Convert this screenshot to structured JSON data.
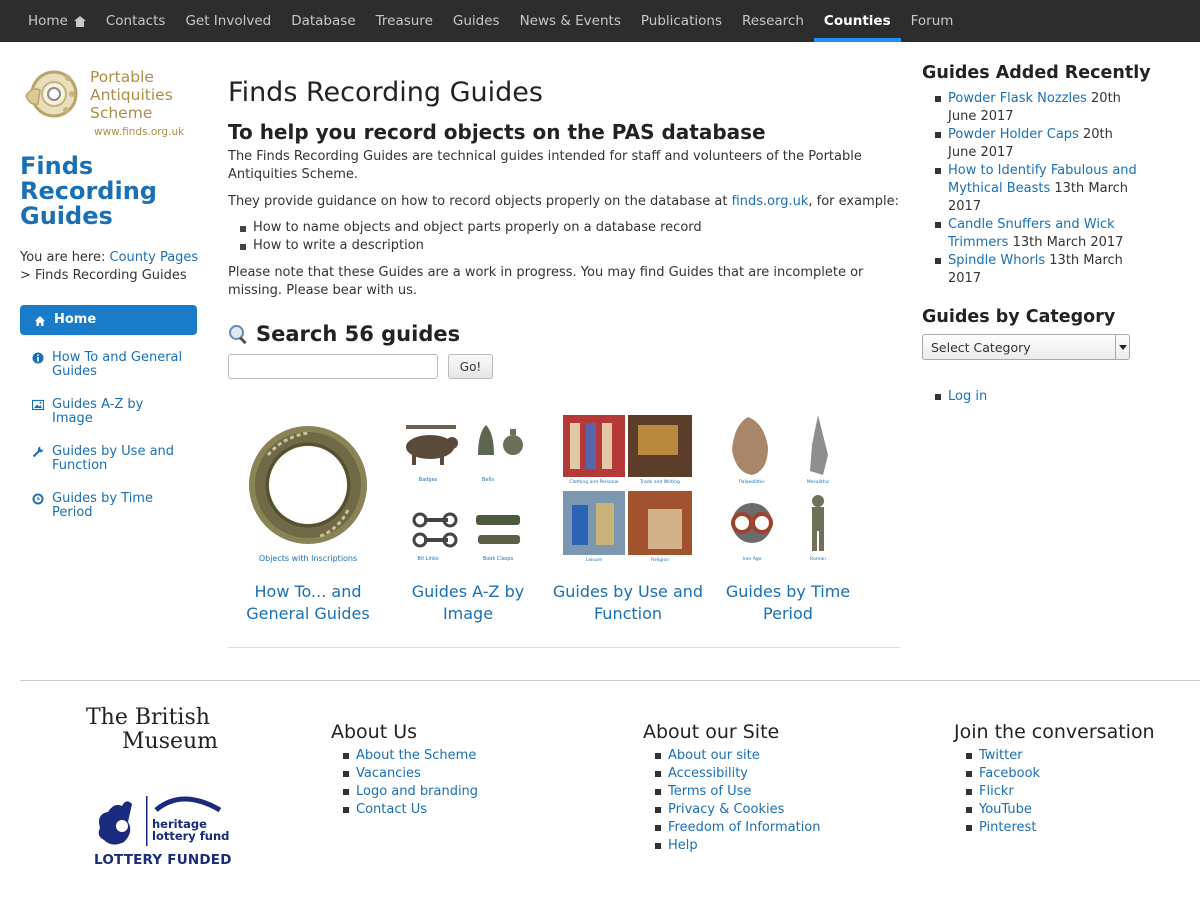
{
  "topnav": {
    "items": [
      {
        "label": "Home",
        "icon": "home-icon"
      },
      {
        "label": "Contacts"
      },
      {
        "label": "Get Involved"
      },
      {
        "label": "Database"
      },
      {
        "label": "Treasure"
      },
      {
        "label": "Guides"
      },
      {
        "label": "News & Events"
      },
      {
        "label": "Publications"
      },
      {
        "label": "Research"
      },
      {
        "label": "Counties",
        "active": true
      },
      {
        "label": "Forum"
      }
    ]
  },
  "logo": {
    "line1": "Portable",
    "line2": "Antiquities",
    "line3": "Scheme",
    "url": "www.finds.org.uk"
  },
  "sidebar": {
    "site_title": "Finds Recording Guides",
    "breadcrumb_prefix": "You are here: ",
    "breadcrumb_link": "County Pages",
    "breadcrumb_sep": " > ",
    "breadcrumb_current": "Finds Recording Guides",
    "items": [
      {
        "label": "Home",
        "icon": "home-icon",
        "active": true
      },
      {
        "label": "How To and General Guides",
        "icon": "info-icon"
      },
      {
        "label": "Guides A-Z by Image",
        "icon": "image-icon"
      },
      {
        "label": "Guides by Use and Function",
        "icon": "wrench-icon"
      },
      {
        "label": "Guides by Time Period",
        "icon": "clock-icon"
      }
    ]
  },
  "main": {
    "title": "Finds Recording Guides",
    "subtitle": "To help you record objects on the PAS database",
    "para1": "The Finds Recording Guides are technical guides intended for staff and volunteers of the Portable Antiquities Scheme.",
    "para2_before": "They provide guidance on how to record objects properly on the database at ",
    "para2_link": "finds.org.uk",
    "para2_after": ", for example:",
    "bullets": [
      "How to name objects and object parts properly on a database record",
      "How to write a description"
    ],
    "para3": "Please note that these Guides are a work in progress. You may find Guides that are incomplete or missing. Please bear with us.",
    "search_title": "Search 56 guides",
    "search_placeholder": "",
    "go_label": "Go!",
    "cards": [
      {
        "caption": "How To... and General Guides",
        "thumb_label": "Objects with Inscriptions"
      },
      {
        "caption": "Guides A-Z by Image",
        "thumb_labels": [
          "Badges",
          "Bells",
          "Bit Links",
          "Book Clasps"
        ]
      },
      {
        "caption": "Guides by Use and Function",
        "thumb_labels": [
          "Clothing and Personal",
          "Trade and Writing",
          "Leisure",
          "Religion"
        ]
      },
      {
        "caption": "Guides by Time Period",
        "thumb_labels": [
          "Palaeolithic",
          "Mesolithic",
          "Iron Age",
          "Roman"
        ]
      }
    ]
  },
  "right": {
    "recent_title": "Guides Added Recently",
    "recent": [
      {
        "link": "Powder Flask Nozzles",
        "date": "20th June 2017"
      },
      {
        "link": "Powder Holder Caps",
        "date": "20th June 2017"
      },
      {
        "link": "How to Identify Fabulous and Mythical Beasts",
        "date": "13th March 2017"
      },
      {
        "link": "Candle Snuffers and Wick Trimmers",
        "date": "13th March 2017"
      },
      {
        "link": "Spindle Whorls",
        "date": "13th March 2017"
      }
    ],
    "category_title": "Guides by Category",
    "category_selected": "Select Category",
    "login": "Log in"
  },
  "footer": {
    "bm_line1": "The British",
    "bm_line2": "Museum",
    "hlf_line1": "heritage",
    "hlf_line2": "lottery fund",
    "lottery_funded": "LOTTERY FUNDED",
    "about_us": {
      "title": "About Us",
      "links": [
        "About the Scheme",
        "Vacancies",
        "Logo and branding",
        "Contact Us"
      ]
    },
    "about_site": {
      "title": "About our Site",
      "links": [
        "About our site",
        "Accessibility",
        "Terms of Use",
        "Privacy & Cookies",
        "Freedom of Information",
        "Help"
      ]
    },
    "join": {
      "title": "Join the conversation",
      "links": [
        "Twitter",
        "Facebook",
        "Flickr",
        "YouTube",
        "Pinterest"
      ]
    }
  },
  "colors": {
    "nav_bg": "#2d2d2d",
    "link": "#1a6fb5",
    "active_nav": "#1a7cc9",
    "logo_gold": "#a98f4a",
    "lottery_blue": "#1a2a7c"
  }
}
